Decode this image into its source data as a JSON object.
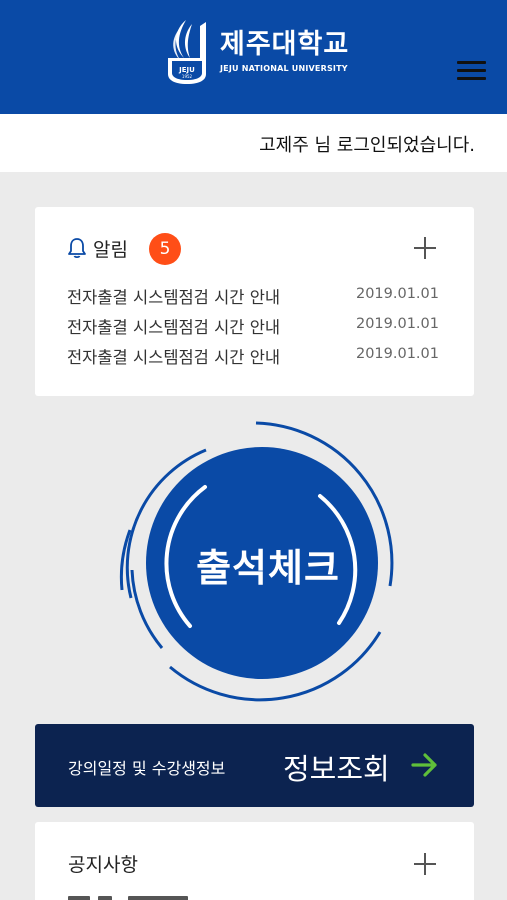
{
  "header": {
    "logo_korean": "제주대학교",
    "logo_english": "JEJU NATIONAL UNIVERSITY",
    "emblem_text": "JEJU",
    "emblem_year": "1952",
    "menu_icon": "hamburger-menu-icon",
    "background_color": "#0a4aa6"
  },
  "login": {
    "message": "고제주 님 로그인되었습니다."
  },
  "alerts": {
    "icon": "bell-icon",
    "title": "알림",
    "count": "5",
    "badge_color": "#ff4e17",
    "more_icon": "plus-icon",
    "items": [
      {
        "title": "전자출결 시스템점검 시간 안내",
        "date": "2019.01.01"
      },
      {
        "title": "전자출결 시스템점검 시간 안내",
        "date": "2019.01.01"
      },
      {
        "title": "전자출결 시스템점검 시간 안내",
        "date": "2019.01.01"
      }
    ]
  },
  "attendance": {
    "label": "출석체크",
    "circle_color": "#0a4aa6"
  },
  "info": {
    "subtitle": "강의일정 및 수강생정보",
    "label": "정보조회",
    "arrow_icon": "arrow-right-icon",
    "background_color": "#0c2350",
    "arrow_color": "#5fbf3a"
  },
  "notices": {
    "title": "공지사항",
    "more_icon": "plus-icon"
  }
}
